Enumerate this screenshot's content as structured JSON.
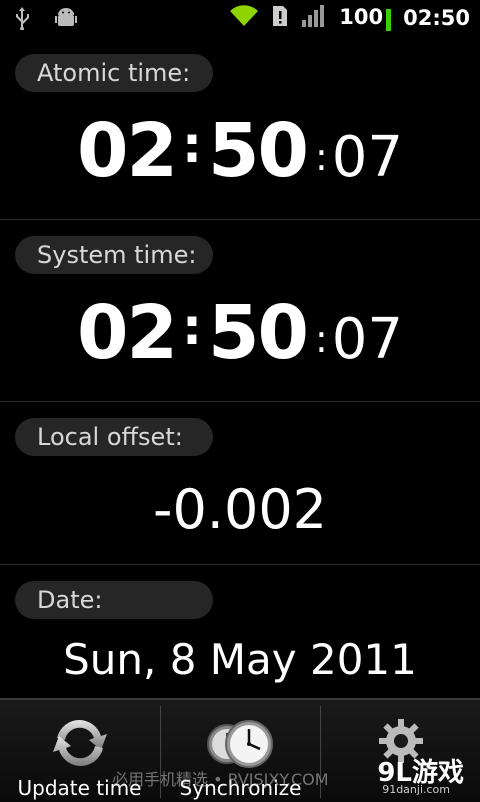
{
  "status_bar": {
    "icons_left": [
      "usb-icon",
      "android-debug-icon"
    ],
    "icons_right": [
      "wifi-icon",
      "alert-icon",
      "signal-icon"
    ],
    "battery": "100",
    "clock": "02:50"
  },
  "atomic": {
    "label": "Atomic time:",
    "hours": "02",
    "minutes": "50",
    "seconds": "07",
    "sep": ":"
  },
  "system": {
    "label": "System time:",
    "hours": "02",
    "minutes": "50",
    "seconds": "07",
    "sep": ":"
  },
  "offset": {
    "label": "Local offset:",
    "value": "-0.002"
  },
  "date": {
    "label": "Date:",
    "value": "Sun, 8 May 2011"
  },
  "toolbar": {
    "update_label": "Update time",
    "sync_label": "Synchronize",
    "settings_label": ""
  },
  "overlay": {
    "watermark": "必用手机精选 • RVJSJXY.COM",
    "logo": "9L游戏",
    "logo_sub": "91danji.com"
  },
  "colors": {
    "battery": "#39d000",
    "wifi": "#8fd400",
    "pill_bg": "#262626"
  }
}
